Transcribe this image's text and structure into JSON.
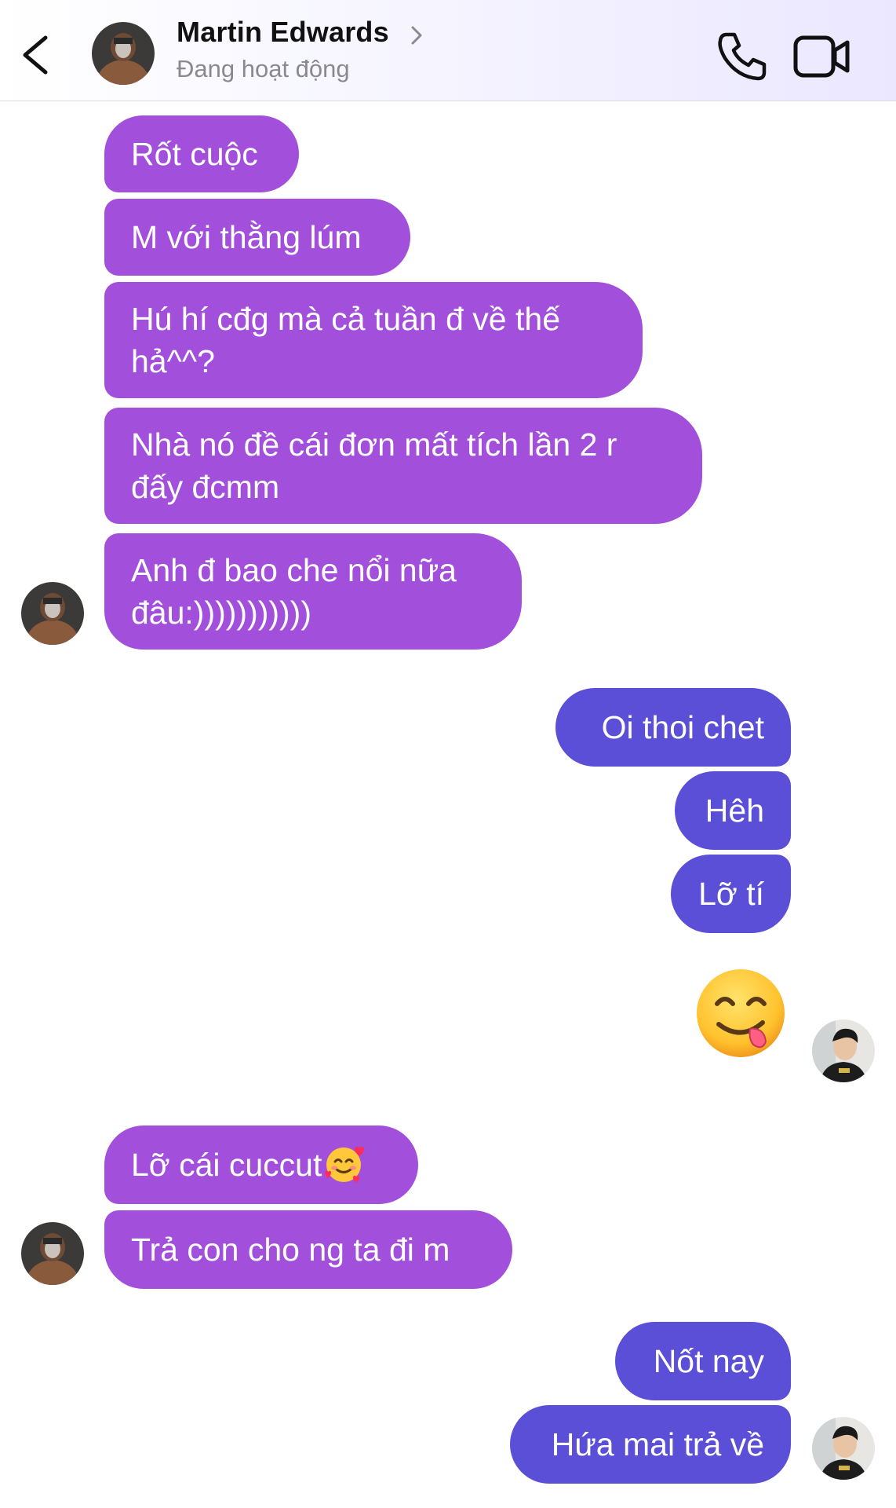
{
  "header": {
    "contact_name": "Martin Edwards",
    "status": "Đang hoạt động",
    "back_icon": "chevron-left-icon",
    "call_icon": "phone-icon",
    "video_icon": "video-camera-icon"
  },
  "colors": {
    "incoming_bubble": "#a24fdc",
    "outgoing_bubble": "#5a4fd6",
    "header_gradient_end": "#ebe7ff"
  },
  "messages": [
    {
      "sender": "contact",
      "text": "Rốt cuộc"
    },
    {
      "sender": "contact",
      "text": "M với thằng lúm"
    },
    {
      "sender": "contact",
      "text": "Hú hí cđg mà cả tuần đ về thế hả^^?"
    },
    {
      "sender": "contact",
      "text": "Nhà nó đề cái đơn mất tích lần 2 r đấy đcmm"
    },
    {
      "sender": "contact",
      "text": "Anh đ bao che nổi nữa đâu:)))))))))))"
    },
    {
      "sender": "me",
      "text": "Oi thoi chet"
    },
    {
      "sender": "me",
      "text": "Hêh"
    },
    {
      "sender": "me",
      "text": "Lỡ tí"
    },
    {
      "sender": "me",
      "emoji": "yum-face-emoji"
    },
    {
      "sender": "contact",
      "text": "Lỡ cái cuccut",
      "emoji": "smiling-face-with-hearts-emoji"
    },
    {
      "sender": "contact",
      "text": "Trả con cho ng ta đi m"
    },
    {
      "sender": "me",
      "text": "Nốt nay"
    },
    {
      "sender": "me",
      "text": "Hứa mai trả về"
    }
  ]
}
